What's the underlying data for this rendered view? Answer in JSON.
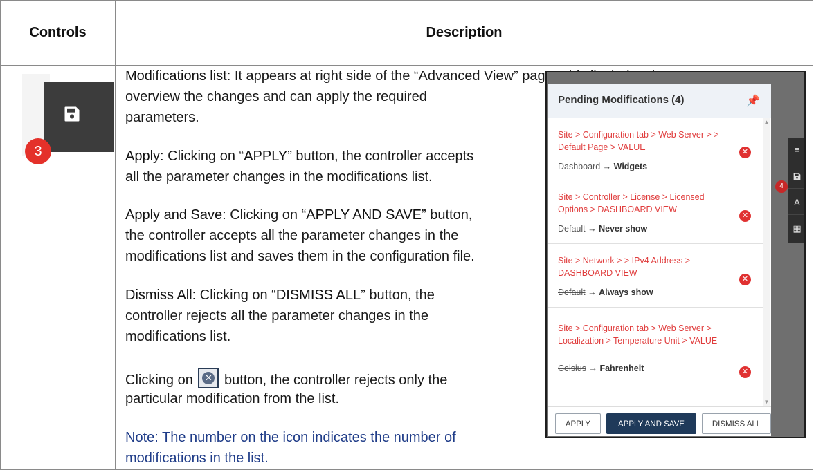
{
  "table": {
    "header_controls": "Controls",
    "header_description": "Description"
  },
  "thumbnail": {
    "badge": "3",
    "icon": "save-icon"
  },
  "description": {
    "modifications_title": "Modifications list",
    "modifications_text": ": It appears at right side of the “Advanced View” page. This list helps the user to",
    "modifications_text2": "overview the changes and can apply the required",
    "modifications_text3": "parameters.",
    "apply_label": "Apply:",
    "apply_text_a": " Clicking on “",
    "apply_btn": "APPLY",
    "apply_text_b": "” button, the controller accepts",
    "apply_text2": "all the parameter changes in the modifications list.",
    "apply_save_label": "Apply and Save:",
    "apply_save_text_a": " Clicking on “",
    "apply_save_btn": "APPLY AND SAVE",
    "apply_save_text_b": "” button,",
    "apply_save_text2": "the controller accepts all the parameter changes in the",
    "apply_save_text3": "modifications list and saves them in the configuration file.",
    "dismiss_label": "Dismiss All:",
    "dismiss_text_a": " Clicking on “",
    "dismiss_btn": "DISMISS ALL",
    "dismiss_text_b": "” button, the",
    "dismiss_text2": "controller rejects all the parameter changes in the",
    "dismiss_text3": "modifications list.",
    "clicking_a": "Clicking on ",
    "clicking_b": " button, the controller rejects only the",
    "clicking_text2": "particular modification from the list.",
    "note_label": "Note",
    "note_text": ": The number on the icon indicates the number of",
    "note_text2": "modifications in the list."
  },
  "panel": {
    "title": "Pending Modifications (4)",
    "pin_icon": "pin-icon",
    "modifications": [
      {
        "path": "Site > Configuration tab > Web Server > > Default Page > VALUE",
        "old": "Dashboard",
        "new": "Widgets"
      },
      {
        "path": "Site > Controller > License > Licensed Options > DASHBOARD VIEW",
        "old": "Default",
        "new": "Never show"
      },
      {
        "path": "Site > Network > > IPv4 Address > DASHBOARD VIEW",
        "old": "Default",
        "new": "Always show"
      },
      {
        "path": "Site > Configuration tab > Web Server > Localization > Temperature Unit > VALUE",
        "old": "Celsius",
        "new": "Fahrenheit"
      }
    ],
    "arrow": "→",
    "buttons": {
      "apply": "APPLY",
      "apply_save": "APPLY AND SAVE",
      "dismiss": "DISMISS ALL"
    },
    "side_badge": "4"
  }
}
